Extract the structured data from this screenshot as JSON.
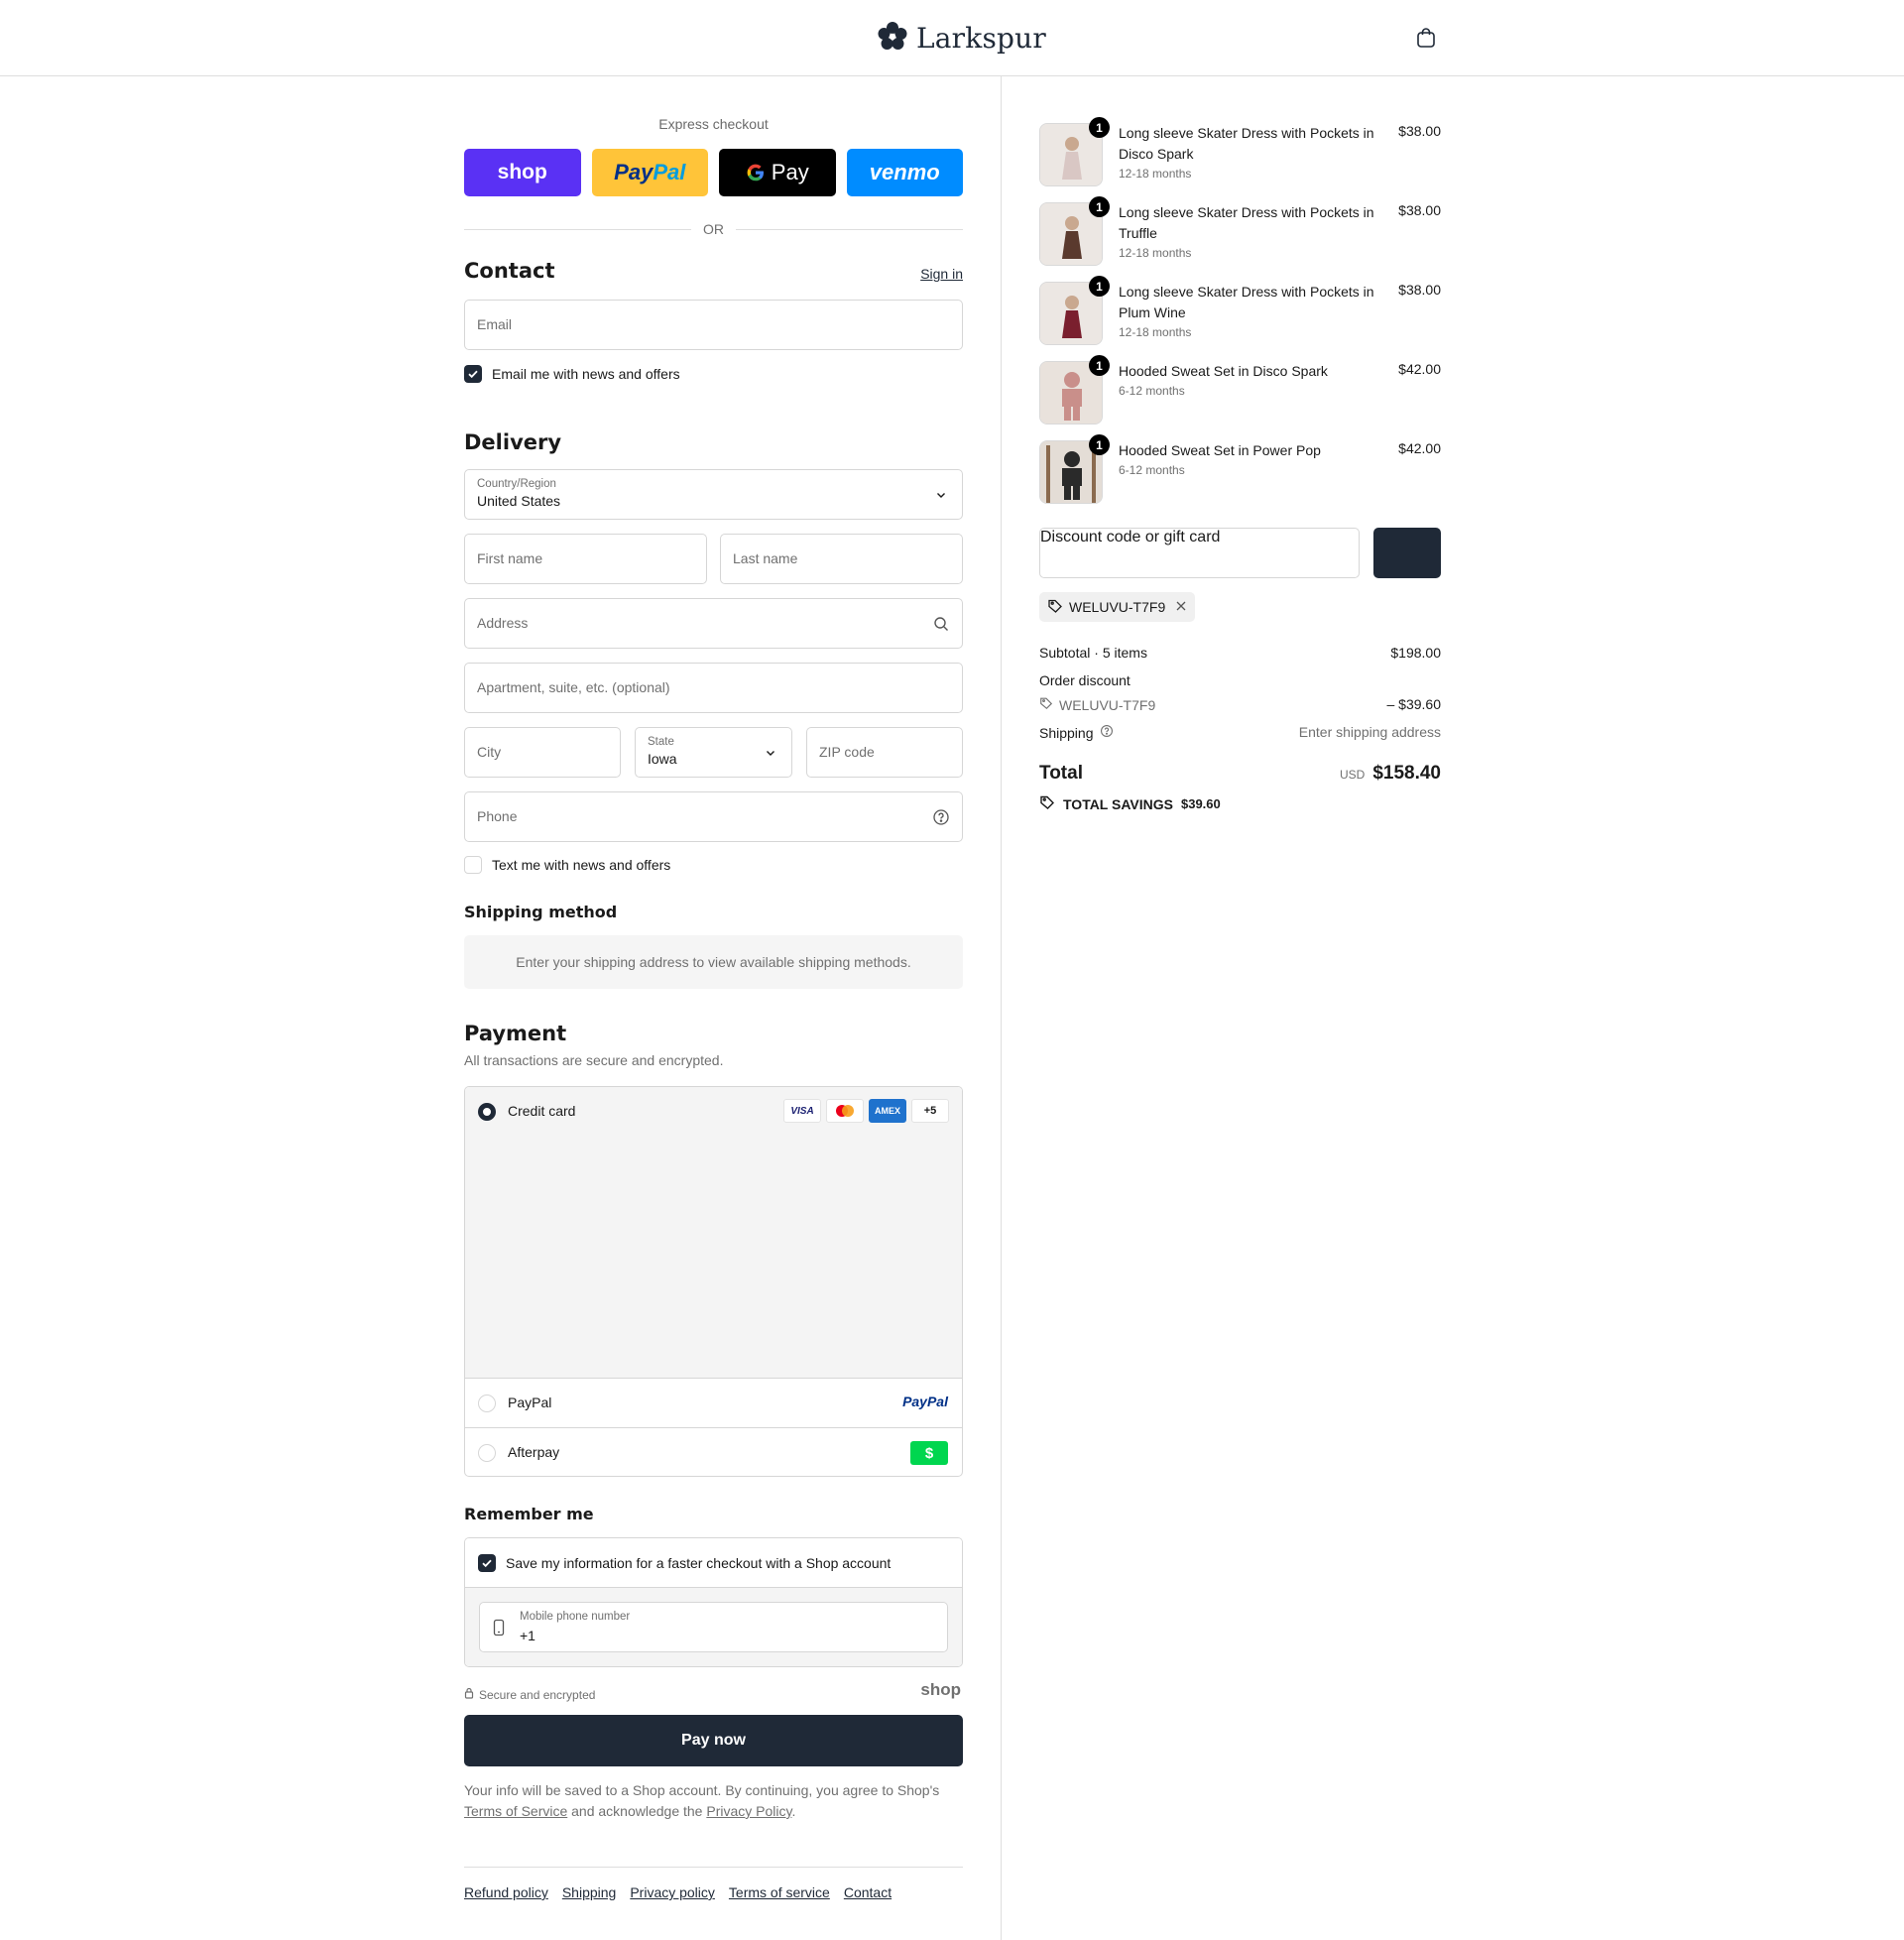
{
  "brand": {
    "name": "Larkspur"
  },
  "express": {
    "label": "Express checkout",
    "shop": "shop",
    "paypal_a": "Pay",
    "paypal_b": "Pal",
    "gpay": "Pay",
    "venmo": "venmo",
    "or": "OR"
  },
  "contact": {
    "title": "Contact",
    "sign_in": "Sign in",
    "email_placeholder": "Email",
    "news_label": "Email me with news and offers"
  },
  "delivery": {
    "title": "Delivery",
    "country_label": "Country/Region",
    "country_value": "United States",
    "first_name": "First name",
    "last_name": "Last name",
    "address": "Address",
    "apartment": "Apartment, suite, etc. (optional)",
    "city": "City",
    "state_label": "State",
    "state_value": "Iowa",
    "zip": "ZIP code",
    "phone": "Phone",
    "text_label": "Text me with news and offers"
  },
  "shipping_method": {
    "title": "Shipping method",
    "notice": "Enter your shipping address to view available shipping methods."
  },
  "payment": {
    "title": "Payment",
    "subtitle": "All transactions are secure and encrypted.",
    "credit_card": "Credit card",
    "card_visa": "VISA",
    "card_amex": "AMEX",
    "card_more": "+5",
    "paypal": "PayPal",
    "paypal_logo": "PayPal",
    "afterpay": "Afterpay",
    "afterpay_logo": "$"
  },
  "remember": {
    "title": "Remember me",
    "save_label": "Save my information for a faster checkout with a Shop account",
    "mobile_label": "Mobile phone number",
    "mobile_value": "+1",
    "secure": "Secure and encrypted",
    "shop_logo": "shop"
  },
  "pay_now": "Pay now",
  "legal": {
    "text1": "Your info will be saved to a Shop account. By continuing, you agree to Shop's",
    "tos": "Terms of Service",
    "text2": "and acknowledge the",
    "privacy": "Privacy Policy",
    "text3": "."
  },
  "footer": {
    "links": [
      "Refund policy",
      "Shipping",
      "Privacy policy",
      "Terms of service",
      "Contact"
    ]
  },
  "cart": {
    "items": [
      {
        "name": "Long sleeve Skater Dress with Pockets in Disco Spark",
        "variant": "12-18 months",
        "price": "$38.00",
        "qty": "1",
        "color": "#d9c7c4"
      },
      {
        "name": "Long sleeve Skater Dress with Pockets in Truffle",
        "variant": "12-18 months",
        "price": "$38.00",
        "qty": "1",
        "color": "#5a3a2e"
      },
      {
        "name": "Long sleeve Skater Dress with Pockets in Plum Wine",
        "variant": "12-18 months",
        "price": "$38.00",
        "qty": "1",
        "color": "#7a1f2e"
      },
      {
        "name": "Hooded Sweat Set in Disco Spark",
        "variant": "6-12 months",
        "price": "$42.00",
        "qty": "1",
        "color": "#c98f8a"
      },
      {
        "name": "Hooded Sweat Set in Power Pop",
        "variant": "6-12 months",
        "price": "$42.00",
        "qty": "1",
        "color": "#2a2a2a"
      }
    ],
    "discount_placeholder": "Discount code or gift card",
    "applied_code": "WELUVU-T7F9"
  },
  "summary": {
    "subtotal_label": "Subtotal · 5 items",
    "subtotal_value": "$198.00",
    "order_discount": "Order discount",
    "discount_code": "WELUVU-T7F9",
    "discount_value": "– $39.60",
    "shipping_label": "Shipping",
    "shipping_value": "Enter shipping address",
    "total_label": "Total",
    "currency": "USD",
    "total_value": "$158.40",
    "savings_label": "TOTAL SAVINGS",
    "savings_value": "$39.60"
  }
}
